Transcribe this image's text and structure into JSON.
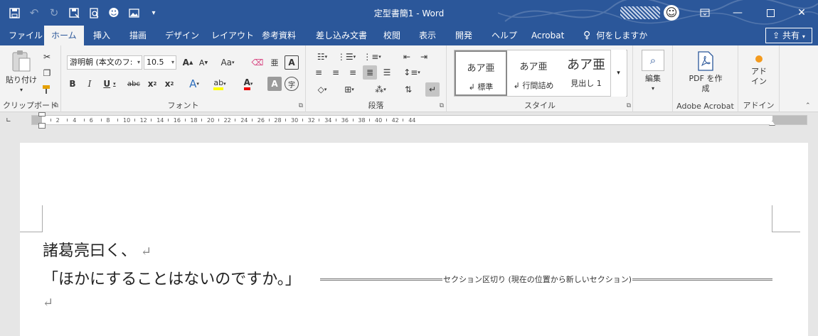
{
  "window": {
    "title": "定型書簡1  -  Word"
  },
  "qat": {
    "icons": [
      "save-icon",
      "undo-icon",
      "redo-icon",
      "save-as-icon",
      "print-preview-icon",
      "smiley-icon",
      "picture-icon",
      "customize-icon"
    ]
  },
  "tabs": [
    "ファイル",
    "ホーム",
    "挿入",
    "描画",
    "デザイン",
    "レイアウト",
    "参考資料",
    "差し込み文書",
    "校閲",
    "表示",
    "開発",
    "ヘルプ",
    "Acrobat"
  ],
  "active_tab": "ホーム",
  "tell_me": "何をしますか",
  "share_label": "共有",
  "ribbon": {
    "clipboard": {
      "paste_label": "貼り付け",
      "group_label": "クリップボード"
    },
    "font": {
      "font_name": "游明朝 (本文のフ:",
      "font_size": "10.5",
      "group_label": "フォント"
    },
    "paragraph": {
      "group_label": "段落"
    },
    "styles": {
      "items": [
        {
          "sample": "あア亜",
          "name": "標準"
        },
        {
          "sample": "あア亜",
          "name": "行間詰め"
        },
        {
          "sample": "あア亜",
          "name": "見出し 1"
        }
      ],
      "group_label": "スタイル"
    },
    "editing": {
      "label": "編集"
    },
    "acrobat": {
      "pdf_label": "PDF を作成",
      "group_label": "Adobe Acrobat"
    },
    "addin": {
      "label": "アドイン",
      "group_label": "アドイン"
    }
  },
  "ruler": {
    "ticks": [
      "2",
      "4",
      "6",
      "8",
      "10",
      "12",
      "14",
      "16",
      "18",
      "20",
      "22",
      "24",
      "26",
      "28",
      "30",
      "32",
      "34",
      "36",
      "38",
      "40",
      "42",
      "44"
    ]
  },
  "document": {
    "line1": "諸葛亮曰く、",
    "line2": "「ほかにすることはないのですか。」",
    "section_break": "セクション区切り (現在の位置から新しいセクション)"
  }
}
